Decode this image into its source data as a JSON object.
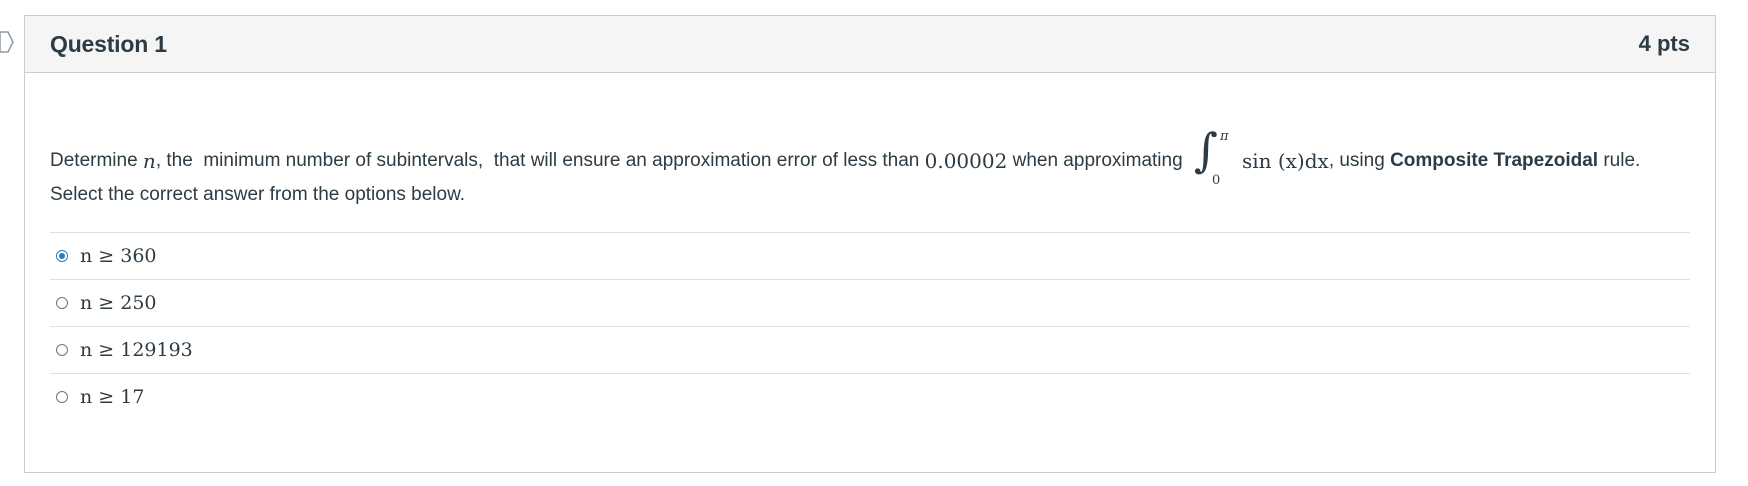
{
  "question": {
    "title": "Question 1",
    "points": "4 pts",
    "prompt": {
      "part1": "Determine ",
      "var_n": "n",
      "part2": ", the  minimum number of subintervals,  that will ensure an approximation error of less than ",
      "tolerance": "0.00002",
      "part3": " when approximating ",
      "integral_upper": "π",
      "integral_lower": "0",
      "integrand": "sin (x)dx",
      "part4": ", using ",
      "method": "Composite Trapezoidal",
      "part5": " rule.",
      "instruction": "Select the correct answer from the options below."
    },
    "answers": [
      {
        "label": "n ≥ 360",
        "selected": true
      },
      {
        "label": "n ≥ 250",
        "selected": false
      },
      {
        "label": "n ≥ 129193",
        "selected": false
      },
      {
        "label": "n ≥ 17",
        "selected": false
      }
    ]
  },
  "colors": {
    "header_bg": "#f5f5f5",
    "border": "#c7cdd1",
    "text": "#2d3b45",
    "radio_selected": "#2b7abc"
  }
}
